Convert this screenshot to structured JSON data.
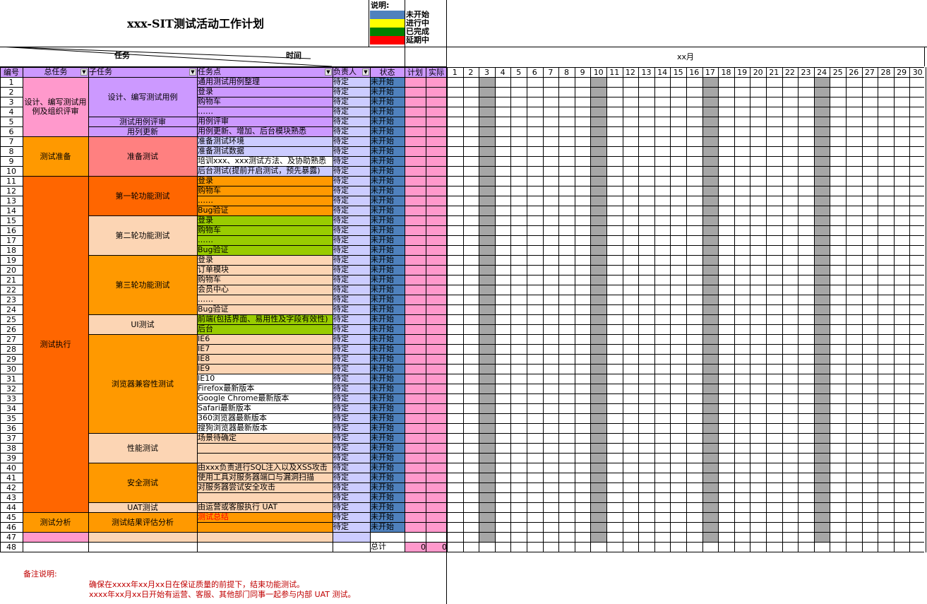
{
  "title": "xxx-SIT测试活动工作计划",
  "legend": {
    "title": "说明:",
    "items": [
      {
        "label": "未开始",
        "color": "#4f81bd"
      },
      {
        "label": "进行中",
        "color": "#ffff00"
      },
      {
        "label": "已完成",
        "color": "#008000"
      },
      {
        "label": "延期中",
        "color": "#ff0000"
      }
    ]
  },
  "diag": {
    "task": "任务",
    "time": "时间"
  },
  "month_label": "xx月",
  "headers": {
    "no": "编号",
    "main": "总任务",
    "sub": "子任务",
    "point": "任务点",
    "owner": "负责人",
    "status": "状态",
    "plan": "计划",
    "actual": "实际"
  },
  "days": [
    "1",
    "2",
    "3",
    "4",
    "5",
    "6",
    "7",
    "8",
    "9",
    "10",
    "11",
    "12",
    "13",
    "14",
    "15",
    "16",
    "17",
    "18",
    "19",
    "20",
    "21",
    "22",
    "23",
    "24",
    "25",
    "26",
    "27",
    "28",
    "29",
    "30"
  ],
  "weekend_days": [
    3,
    10,
    17,
    24
  ],
  "colors": {
    "header_bg": "#ccffff",
    "month_bg": "#bfbfbf",
    "col_header": "#cc99ff",
    "owner": "#ccccff",
    "status": "#4f81bd",
    "plan": "#ff99cc",
    "actual": "#ff99cc",
    "gantt_weekend": "#a6a6a6"
  },
  "main_tasks": [
    {
      "name": "设计、编写测试用例及组织评审",
      "rows": [
        1,
        6
      ],
      "color": "#ff99cc"
    },
    {
      "name": "测试准备",
      "rows": [
        7,
        10
      ],
      "color": "#ff9900"
    },
    {
      "name": "测试执行",
      "rows": [
        11,
        44
      ],
      "color": "#ff6600"
    },
    {
      "name": "测试分析",
      "rows": [
        45,
        46
      ],
      "color": "#ff9900"
    },
    {
      "name": "",
      "rows": [
        47,
        47
      ],
      "color": "#ff99cc"
    }
  ],
  "sub_tasks": [
    {
      "name": "设计、编写测试用例",
      "rows": [
        1,
        4
      ],
      "color": "#cc99ff"
    },
    {
      "name": "测试用例评审",
      "rows": [
        5,
        5
      ],
      "color": "#cc99ff"
    },
    {
      "name": "用列更新",
      "rows": [
        6,
        6
      ],
      "color": "#cc99ff"
    },
    {
      "name": "准备测试",
      "rows": [
        7,
        10
      ],
      "color": "#ff8080"
    },
    {
      "name": "第一轮功能测试",
      "rows": [
        11,
        14
      ],
      "color": "#ff6600"
    },
    {
      "name": "第二轮功能测试",
      "rows": [
        15,
        18
      ],
      "color": "#fcd5b4"
    },
    {
      "name": "第三轮功能测试",
      "rows": [
        19,
        24
      ],
      "color": "#ff9900"
    },
    {
      "name": "UI测试",
      "rows": [
        25,
        26
      ],
      "color": "#fcd5b4"
    },
    {
      "name": "浏览器兼容性测试",
      "rows": [
        27,
        36
      ],
      "color": "#ff9900"
    },
    {
      "name": "性能测试",
      "rows": [
        37,
        39
      ],
      "color": "#fcd5b4"
    },
    {
      "name": "安全测试",
      "rows": [
        40,
        43
      ],
      "color": "#ff9900"
    },
    {
      "name": "UAT测试",
      "rows": [
        44,
        44
      ],
      "color": "#fcd5b4"
    },
    {
      "name": "测试结果评估分析",
      "rows": [
        45,
        46
      ],
      "color": "#ff9900"
    },
    {
      "name": "",
      "rows": [
        47,
        47
      ],
      "color": "#fcd5b4"
    }
  ],
  "rows": [
    {
      "no": "1",
      "point": "通用测试用例整理",
      "owner": "待定",
      "status": "未开始",
      "color": "#cc99ff"
    },
    {
      "no": "2",
      "point": "登录",
      "owner": "待定",
      "status": "未开始",
      "color": "#cc99ff"
    },
    {
      "no": "3",
      "point": "购物车",
      "owner": "待定",
      "status": "未开始",
      "color": "#cc99ff"
    },
    {
      "no": "4",
      "point": "……",
      "owner": "待定",
      "status": "未开始",
      "color": "#cc99ff"
    },
    {
      "no": "5",
      "point": "用例评审",
      "owner": "待定",
      "status": "未开始",
      "color": "#cc99ff"
    },
    {
      "no": "6",
      "point": "用例更新、增加、后台模块熟悉",
      "owner": "待定",
      "status": "未开始",
      "color": "#cc99ff"
    },
    {
      "no": "7",
      "point": "准备测试环境",
      "owner": "待定",
      "status": "未开始",
      "color": "#ccccff"
    },
    {
      "no": "8",
      "point": "准备测试数据",
      "owner": "待定",
      "status": "未开始",
      "color": "#ccccff"
    },
    {
      "no": "9",
      "point": "培训xxx、xxx测试方法、及协助熟悉",
      "owner": "待定",
      "status": "未开始",
      "color": "#ffffff"
    },
    {
      "no": "10",
      "point": "后台测试(提前开启测试，预先暴露)",
      "owner": "待定",
      "status": "未开始",
      "color": "#ccccff"
    },
    {
      "no": "11",
      "point": "登录",
      "owner": "待定",
      "status": "未开始",
      "color": "#ff9900"
    },
    {
      "no": "12",
      "point": "购物车",
      "owner": "待定",
      "status": "未开始",
      "color": "#ff9900"
    },
    {
      "no": "13",
      "point": "……",
      "owner": "待定",
      "status": "未开始",
      "color": "#ff9900"
    },
    {
      "no": "14",
      "point": "Bug验证",
      "owner": "待定",
      "status": "未开始",
      "color": "#ff9900"
    },
    {
      "no": "15",
      "point": "登录",
      "owner": "待定",
      "status": "未开始",
      "color": "#99cc00"
    },
    {
      "no": "16",
      "point": "购物车",
      "owner": "待定",
      "status": "未开始",
      "color": "#99cc00"
    },
    {
      "no": "17",
      "point": "……",
      "owner": "待定",
      "status": "未开始",
      "color": "#99cc00"
    },
    {
      "no": "18",
      "point": "Bug验证",
      "owner": "待定",
      "status": "未开始",
      "color": "#99cc00"
    },
    {
      "no": "19",
      "point": "登录",
      "owner": "待定",
      "status": "未开始",
      "color": "#fcd5b4"
    },
    {
      "no": "20",
      "point": "订单模块",
      "owner": "待定",
      "status": "未开始",
      "color": "#fcd5b4"
    },
    {
      "no": "21",
      "point": "购物车",
      "owner": "待定",
      "status": "未开始",
      "color": "#fcd5b4"
    },
    {
      "no": "22",
      "point": "会员中心",
      "owner": "待定",
      "status": "未开始",
      "color": "#fcd5b4"
    },
    {
      "no": "23",
      "point": "……",
      "owner": "待定",
      "status": "未开始",
      "color": "#fcd5b4"
    },
    {
      "no": "24",
      "point": "Bug验证",
      "owner": "待定",
      "status": "未开始",
      "color": "#fcd5b4"
    },
    {
      "no": "25",
      "point": "前端(包括界面、易用性及字段有效性)",
      "owner": "待定",
      "status": "未开始",
      "color": "#99cc00"
    },
    {
      "no": "26",
      "point": "后台",
      "owner": "待定",
      "status": "未开始",
      "color": "#99cc00"
    },
    {
      "no": "27",
      "point": "IE6",
      "owner": "待定",
      "status": "未开始",
      "color": "#fcd5b4"
    },
    {
      "no": "28",
      "point": "IE7",
      "owner": "待定",
      "status": "未开始",
      "color": "#fcd5b4"
    },
    {
      "no": "29",
      "point": "IE8",
      "owner": "待定",
      "status": "未开始",
      "color": "#fcd5b4"
    },
    {
      "no": "30",
      "point": "IE9",
      "owner": "待定",
      "status": "未开始",
      "color": "#fcd5b4"
    },
    {
      "no": "31",
      "point": "IE10",
      "owner": "待定",
      "status": "未开始",
      "color": "#ffffff"
    },
    {
      "no": "32",
      "point": "Firefox最新版本",
      "owner": "待定",
      "status": "未开始",
      "color": "#ffffff"
    },
    {
      "no": "33",
      "point": "Google Chrome最新版本",
      "owner": "待定",
      "status": "未开始",
      "color": "#ffffff"
    },
    {
      "no": "34",
      "point": "Safari最新版本",
      "owner": "待定",
      "status": "未开始",
      "color": "#ffffff"
    },
    {
      "no": "35",
      "point": "360浏览器最新版本",
      "owner": "待定",
      "status": "未开始",
      "color": "#ffffff"
    },
    {
      "no": "36",
      "point": "搜狗浏览器最新版本",
      "owner": "待定",
      "status": "未开始",
      "color": "#ffffff"
    },
    {
      "no": "37",
      "point": "场景待确定",
      "owner": "待定",
      "status": "未开始",
      "color": "#fcd5b4"
    },
    {
      "no": "38",
      "point": "",
      "owner": "待定",
      "status": "未开始",
      "color": "#fcd5b4"
    },
    {
      "no": "39",
      "point": "",
      "owner": "待定",
      "status": "未开始",
      "color": "#fcd5b4"
    },
    {
      "no": "40",
      "point": "由xxx负责进行SQL注入以及XSS攻击",
      "owner": "待定",
      "status": "未开始",
      "color": "#fcd5b4"
    },
    {
      "no": "41",
      "point": "使用工具对服务器端口与漏洞扫描",
      "owner": "待定",
      "status": "未开始",
      "color": "#fcd5b4"
    },
    {
      "no": "42",
      "point": "对服务器尝试安全攻击",
      "owner": "待定",
      "status": "未开始",
      "color": "#fcd5b4"
    },
    {
      "no": "43",
      "point": "",
      "owner": "待定",
      "status": "未开始",
      "color": "#fcd5b4"
    },
    {
      "no": "44",
      "point": "由运营或客服执行 UAT",
      "owner": "待定",
      "status": "未开始",
      "color": "#fcd5b4"
    },
    {
      "no": "45",
      "point": "测试总结",
      "owner": "待定",
      "status": "未开始",
      "color": "#ff9900",
      "text_color": "#ff0000"
    },
    {
      "no": "46",
      "point": "",
      "owner": "待定",
      "status": "未开始",
      "color": "#ff9900"
    },
    {
      "no": "47",
      "point": "",
      "owner": "",
      "status": "",
      "color": "#fcd5b4"
    }
  ],
  "total": {
    "no": "48",
    "label": "总计",
    "plan": "0",
    "actual": "0"
  },
  "notes": {
    "title": "备注说明:",
    "lines": [
      "确保在xxxx年xx月xx日在保证质量的前提下，结束功能测试。",
      "xxxx年xx月xx日开始有运营、客服、其他部门同事一起参与内部 UAT 测试。"
    ]
  }
}
